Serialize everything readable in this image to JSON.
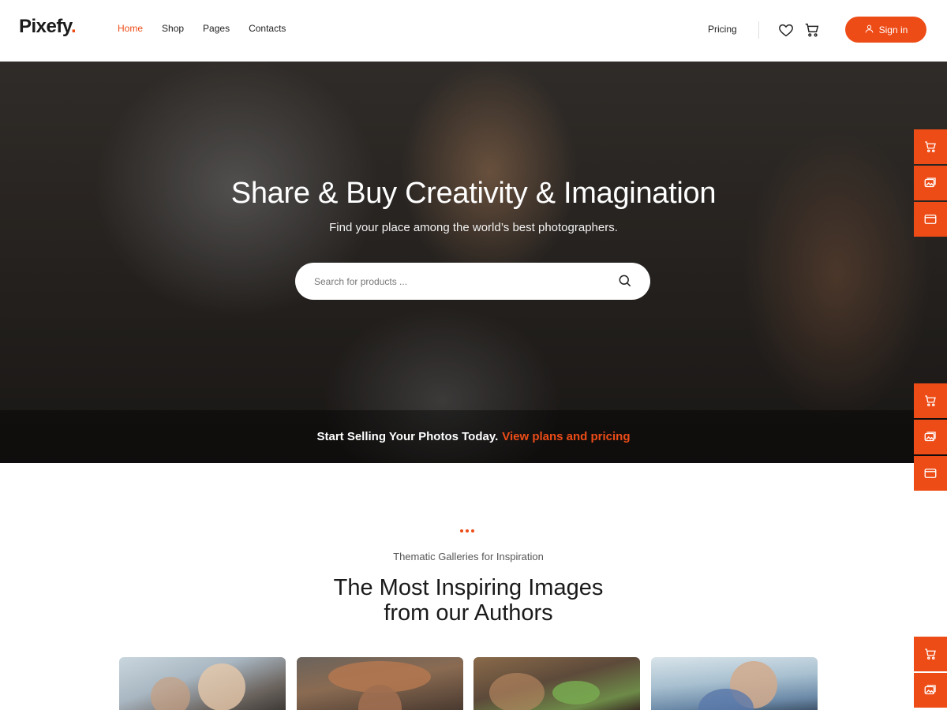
{
  "header": {
    "logo": "Pixefy",
    "logo_dot": ".",
    "nav": [
      {
        "label": "Home",
        "active": true
      },
      {
        "label": "Shop",
        "active": false
      },
      {
        "label": "Pages",
        "active": false
      },
      {
        "label": "Contacts",
        "active": false
      }
    ],
    "pricing_label": "Pricing",
    "signin_label": "Sign in",
    "icons": [
      "heart-icon",
      "cart-icon",
      "user-icon"
    ]
  },
  "hero": {
    "title": "Share & Buy Creativity & Imagination",
    "subtitle": "Find your place among the world’s best photographers.",
    "search": {
      "placeholder": "Search for products ...",
      "value": ""
    },
    "band_text": "Start Selling Your Photos Today.",
    "band_link": "View plans and pricing"
  },
  "side_toolbar": {
    "groups": [
      [
        "cart-icon",
        "gallery-icon",
        "browser-window-icon"
      ],
      [
        "cart-icon",
        "gallery-icon",
        "browser-window-icon"
      ],
      [
        "cart-icon",
        "gallery-icon"
      ]
    ]
  },
  "section": {
    "eyebrow": "Thematic Galleries for Inspiration",
    "title_line1": "The Most Inspiring Images",
    "title_line2": "from our Authors"
  },
  "colors": {
    "accent": "#ee4c17",
    "text": "#222222"
  }
}
